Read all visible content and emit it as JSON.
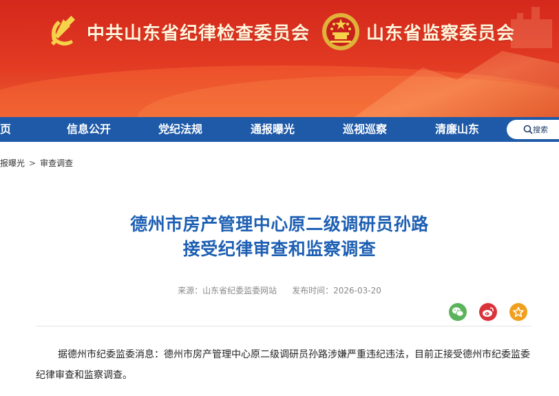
{
  "header": {
    "title_party": "中共山东省纪律检查委员会",
    "title_state": "山东省监察委员会",
    "colors": {
      "banner": "#d4281c",
      "title_text": "#fff6dc"
    }
  },
  "nav": {
    "items": [
      {
        "label": "页"
      },
      {
        "label": "信息公开"
      },
      {
        "label": "党纪法规"
      },
      {
        "label": "通报曝光"
      },
      {
        "label": "巡视巡察"
      },
      {
        "label": "清廉山东"
      }
    ],
    "search_label": "搜索",
    "color": "#1e5aa8"
  },
  "breadcrumb": {
    "items": [
      "报曝光",
      "审查调查"
    ],
    "separator": ">"
  },
  "article": {
    "title_line1": "德州市房产管理中心原二级调研员孙路",
    "title_line2": "接受纪律审查和监察调查",
    "source": "来源：山东省纪委监委网站",
    "published": "发布时间：2026-03-20",
    "body": "据德州市纪委监委消息：德州市房产管理中心原二级调研员孙路涉嫌严重违纪违法，目前正接受德州市纪委监委纪律审查和监察调查。",
    "title_color": "#1d5fb3"
  },
  "share": [
    {
      "icon": "wechat-icon",
      "color": "#5bb35b"
    },
    {
      "icon": "weibo-icon",
      "color": "#d9343b"
    },
    {
      "icon": "star-icon",
      "color": "#f0a020"
    }
  ]
}
